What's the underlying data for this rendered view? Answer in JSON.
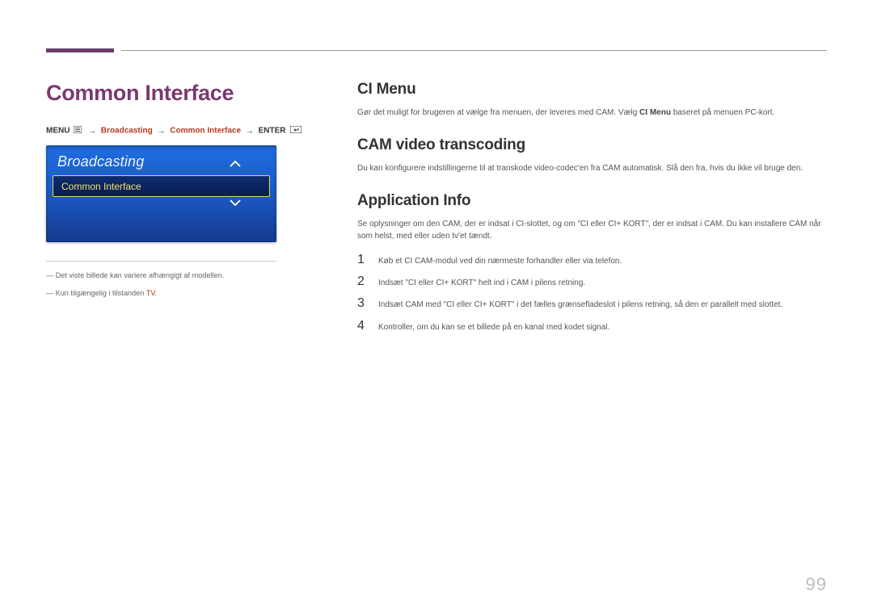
{
  "page": {
    "title": "Common Interface",
    "number": "99"
  },
  "breadcrumb": {
    "menu": "MENU",
    "arrow": "→",
    "broadcasting": "Broadcasting",
    "common_interface": "Common Interface",
    "enter": "ENTER"
  },
  "tv_panel": {
    "title": "Broadcasting",
    "selected_item": "Common Interface"
  },
  "notes": {
    "n1_prefix": "―",
    "n1": "Det viste billede kan variere afhængigt af modellen.",
    "n2_pre": "―",
    "n2_text1": "Kun tilgængelig i tilstanden ",
    "n2_hl": "TV",
    "n2_text2": "."
  },
  "sections": {
    "ci_menu": {
      "title": "CI Menu",
      "body_pre": "Gør det muligt for brugeren at vælge fra menuen, der leveres med CAM. Vælg ",
      "body_bold": "CI Menu",
      "body_post": " baseret på menuen PC-kort."
    },
    "cam": {
      "title": "CAM video transcoding",
      "body": "Du kan konfigurere indstillingerne til at transkode video-codec'en fra CAM automatisk. Slå den fra, hvis du ikke vil bruge den."
    },
    "app_info": {
      "title": "Application Info",
      "body": "Se oplysninger om den CAM, der er indsat i CI-slottet, og om \"CI eller CI+ KORT\", der er indsat i CAM. Du kan installere CAM når som helst, med eller uden tv'et tændt.",
      "steps": {
        "1": "Køb et CI CAM-modul ved din nærmeste forhandler eller via telefon.",
        "2": "Indsæt \"CI eller CI+ KORT\" helt ind i CAM i pilens retning.",
        "3": "Indsæt CAM med \"CI eller CI+ KORT\" i det fælles grænsefladeslot i pilens retning, så den er parallelt med slottet.",
        "4": "Kontroller, om du kan se et billede på en kanal med kodet signal."
      }
    }
  }
}
